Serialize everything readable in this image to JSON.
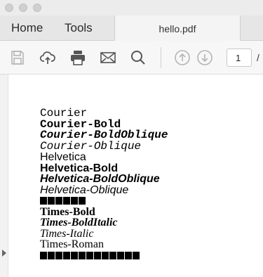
{
  "nav": {
    "home_label": "Home",
    "tools_label": "Tools"
  },
  "document_tab": {
    "title": "hello.pdf"
  },
  "toolbar": {
    "icons": [
      "save-icon",
      "cloud-upload-icon",
      "print-icon",
      "email-icon",
      "search-icon",
      "page-up-icon",
      "page-down-icon"
    ],
    "page_number": "1",
    "page_separator": "/"
  },
  "pdf": {
    "lines": [
      "Courier",
      "Courier-Bold",
      "Courier-BoldOblique",
      "Courier-Oblique",
      "Helvetica",
      "Helvetica-Bold",
      "Helvetica-BoldOblique",
      "Helvetica-Oblique",
      "Times-Bold",
      "Times-BoldItalic",
      "Times-Italic",
      "Times-Roman"
    ],
    "symbol_block_count": 6,
    "dingbat_block_count": 13
  }
}
